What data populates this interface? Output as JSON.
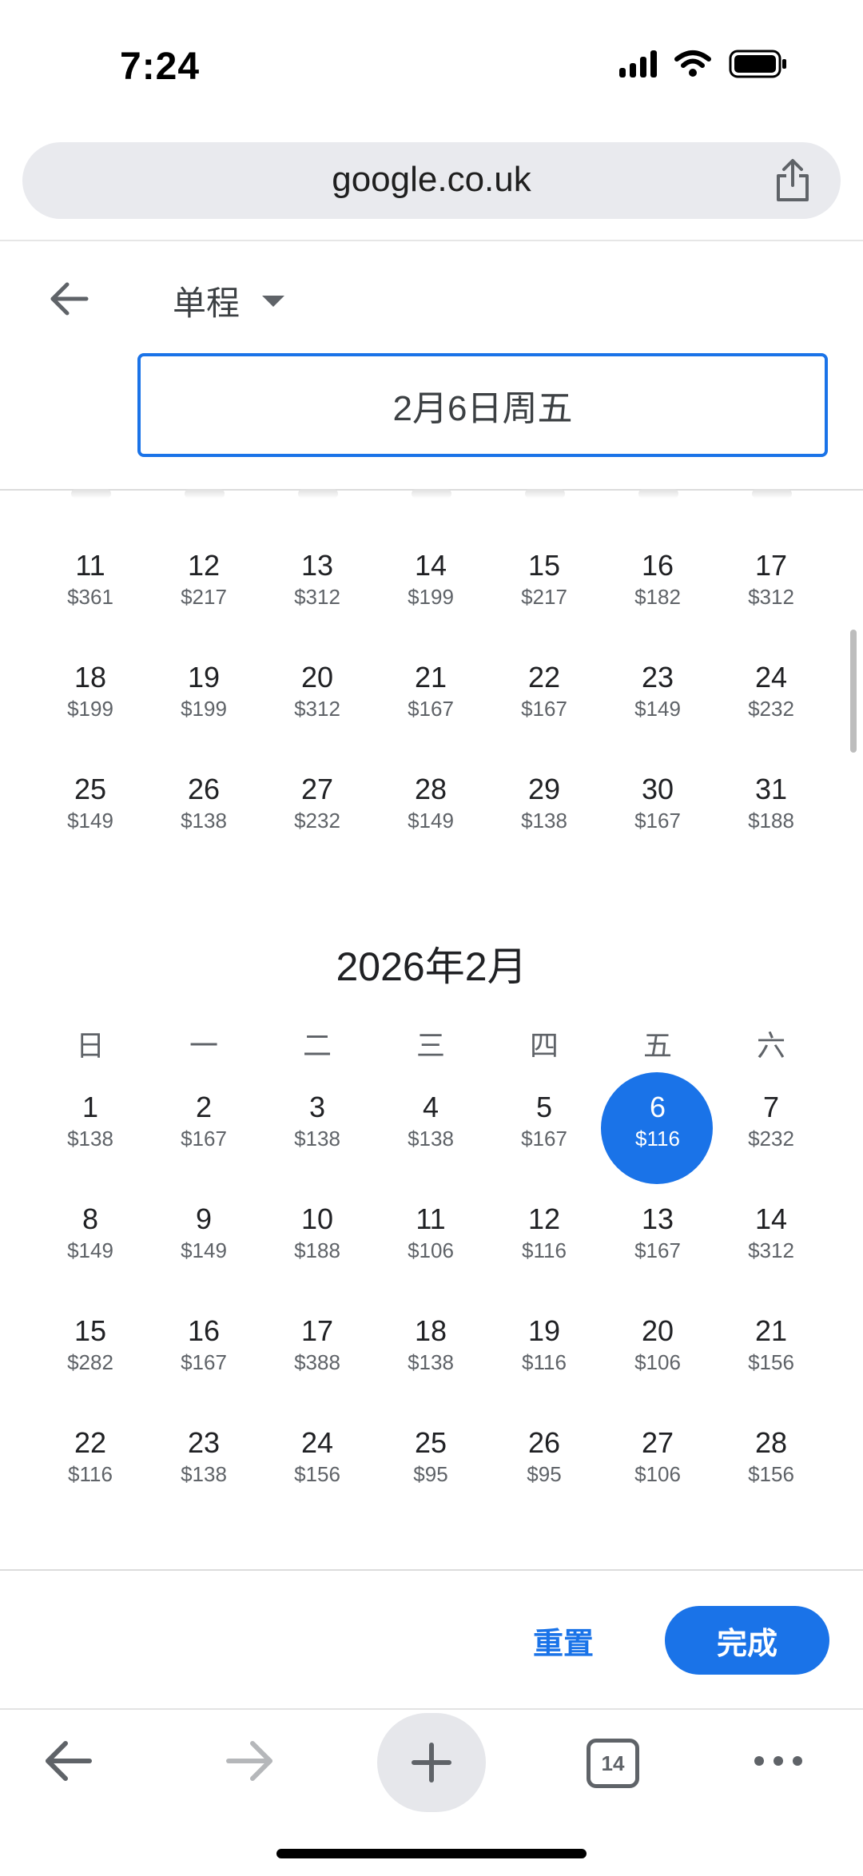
{
  "status_bar": {
    "time": "7:24"
  },
  "browser": {
    "url": "google.co.uk",
    "tab_count": "14"
  },
  "header": {
    "trip_type": "单程",
    "selected_date": "2月6日周五"
  },
  "prev_month_rows": [
    [
      {
        "d": "11",
        "p": "$361"
      },
      {
        "d": "12",
        "p": "$217"
      },
      {
        "d": "13",
        "p": "$312"
      },
      {
        "d": "14",
        "p": "$199"
      },
      {
        "d": "15",
        "p": "$217"
      },
      {
        "d": "16",
        "p": "$182"
      },
      {
        "d": "17",
        "p": "$312"
      }
    ],
    [
      {
        "d": "18",
        "p": "$199"
      },
      {
        "d": "19",
        "p": "$199"
      },
      {
        "d": "20",
        "p": "$312"
      },
      {
        "d": "21",
        "p": "$167"
      },
      {
        "d": "22",
        "p": "$167"
      },
      {
        "d": "23",
        "p": "$149"
      },
      {
        "d": "24",
        "p": "$232"
      }
    ],
    [
      {
        "d": "25",
        "p": "$149"
      },
      {
        "d": "26",
        "p": "$138"
      },
      {
        "d": "27",
        "p": "$232"
      },
      {
        "d": "28",
        "p": "$149"
      },
      {
        "d": "29",
        "p": "$138"
      },
      {
        "d": "30",
        "p": "$167"
      },
      {
        "d": "31",
        "p": "$188"
      }
    ]
  ],
  "month": {
    "title": "2026年2月",
    "weekdays": [
      "日",
      "一",
      "二",
      "三",
      "四",
      "五",
      "六"
    ],
    "rows": [
      [
        {
          "d": "1",
          "p": "$138"
        },
        {
          "d": "2",
          "p": "$167"
        },
        {
          "d": "3",
          "p": "$138"
        },
        {
          "d": "4",
          "p": "$138"
        },
        {
          "d": "5",
          "p": "$167"
        },
        {
          "d": "6",
          "p": "$116",
          "selected": true
        },
        {
          "d": "7",
          "p": "$232"
        }
      ],
      [
        {
          "d": "8",
          "p": "$149"
        },
        {
          "d": "9",
          "p": "$149"
        },
        {
          "d": "10",
          "p": "$188"
        },
        {
          "d": "11",
          "p": "$106"
        },
        {
          "d": "12",
          "p": "$116"
        },
        {
          "d": "13",
          "p": "$167"
        },
        {
          "d": "14",
          "p": "$312"
        }
      ],
      [
        {
          "d": "15",
          "p": "$282"
        },
        {
          "d": "16",
          "p": "$167"
        },
        {
          "d": "17",
          "p": "$388"
        },
        {
          "d": "18",
          "p": "$138"
        },
        {
          "d": "19",
          "p": "$116"
        },
        {
          "d": "20",
          "p": "$106"
        },
        {
          "d": "21",
          "p": "$156"
        }
      ],
      [
        {
          "d": "22",
          "p": "$116"
        },
        {
          "d": "23",
          "p": "$138"
        },
        {
          "d": "24",
          "p": "$156"
        },
        {
          "d": "25",
          "p": "$95"
        },
        {
          "d": "26",
          "p": "$95"
        },
        {
          "d": "27",
          "p": "$106"
        },
        {
          "d": "28",
          "p": "$156"
        }
      ]
    ]
  },
  "footer": {
    "reset_label": "重置",
    "done_label": "完成"
  },
  "colors": {
    "accent": "#1a73e8",
    "text": "#202124",
    "muted": "#5f6368"
  },
  "icons": [
    "signal-icon",
    "wifi-icon",
    "battery-icon",
    "share-icon",
    "back-arrow-icon",
    "dropdown-caret-icon",
    "nav-back-icon",
    "nav-forward-icon",
    "new-tab-icon",
    "tabs-icon",
    "more-icon"
  ]
}
